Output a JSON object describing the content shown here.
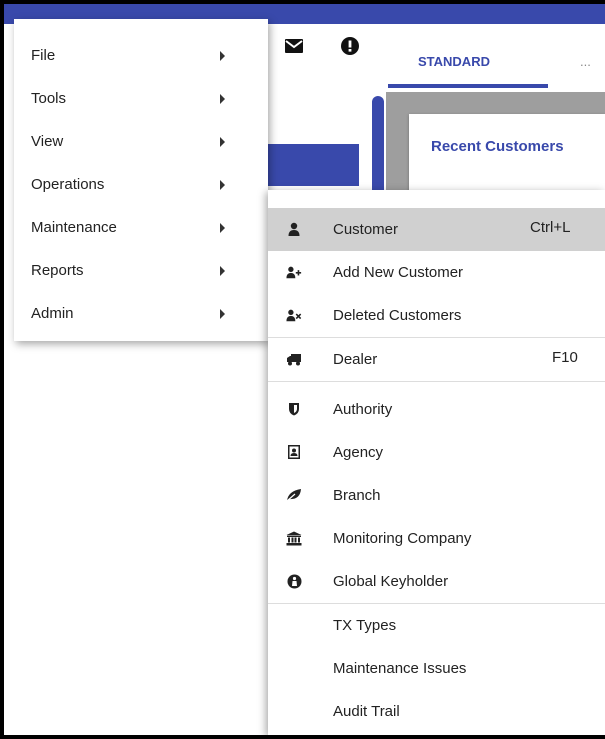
{
  "header": {
    "tabs": [
      {
        "label": "STANDARD"
      },
      {
        "label": "..."
      }
    ]
  },
  "recent": {
    "title": "Recent Customers"
  },
  "main_menu": {
    "items": [
      {
        "label": "File"
      },
      {
        "label": "Tools"
      },
      {
        "label": "View"
      },
      {
        "label": "Operations"
      },
      {
        "label": "Maintenance"
      },
      {
        "label": "Reports"
      },
      {
        "label": "Admin"
      }
    ]
  },
  "submenu": {
    "items": [
      {
        "label": "Customer",
        "shortcut": "Ctrl+L",
        "icon": "user-icon"
      },
      {
        "label": "Add New Customer",
        "icon": "user-plus-icon"
      },
      {
        "label": "Deleted Customers",
        "icon": "user-times-icon"
      },
      {
        "label": "Dealer",
        "shortcut": "F10",
        "icon": "truck-icon"
      },
      {
        "label": "Authority",
        "icon": "shield-icon"
      },
      {
        "label": "Agency",
        "icon": "portrait-icon"
      },
      {
        "label": "Branch",
        "icon": "leaf-icon"
      },
      {
        "label": "Monitoring Company",
        "icon": "bank-icon"
      },
      {
        "label": "Global Keyholder",
        "icon": "keyholder-icon"
      },
      {
        "label": "TX Types"
      },
      {
        "label": "Maintenance Issues"
      },
      {
        "label": "Audit Trail"
      }
    ]
  },
  "colors": {
    "accent": "#3949ab",
    "highlight": "#d0d0d0",
    "backdrop": "#9e9e9e"
  }
}
